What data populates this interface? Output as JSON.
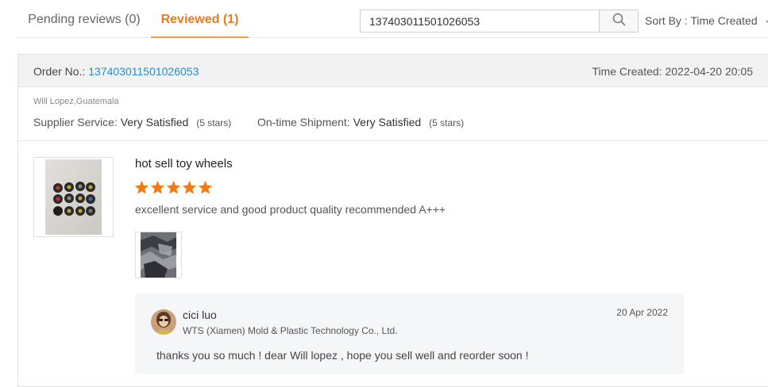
{
  "tabs": {
    "pending_label": "Pending reviews (0)",
    "reviewed_label": "Reviewed (1)"
  },
  "search": {
    "value": "137403011501026053",
    "icon": "search-icon"
  },
  "sort": {
    "label": "Sort By : Time Created",
    "icon": "chevron-down-icon"
  },
  "order": {
    "label": "Order No.:",
    "number": "137403011501026053",
    "time_created": "Time Created: 2022-04-20 20:05"
  },
  "buyer": {
    "name_location": "Will Lopez,Guatemala"
  },
  "ratings": {
    "supplier_label": "Supplier Service:",
    "supplier_value": "Very Satisfied",
    "supplier_stars": "(5 stars)",
    "shipment_label": "On-time Shipment:",
    "shipment_value": "Very Satisfied",
    "shipment_stars": "(5 stars)"
  },
  "product": {
    "title": "hot sell toy wheels",
    "star_rating": 5,
    "review": "excellent service and good product quality recommended A+++"
  },
  "reply": {
    "name": "cici luo",
    "company": "WTS (Xiamen) Mold & Plastic Technology Co., Ltd.",
    "date": "20 Apr 2022",
    "text": "thanks you so much ! dear Will lopez , hope you sell well and reorder soon !"
  },
  "colors": {
    "accent": "#e87c1e",
    "star": "#f5790e",
    "link": "#2a8ccf"
  }
}
